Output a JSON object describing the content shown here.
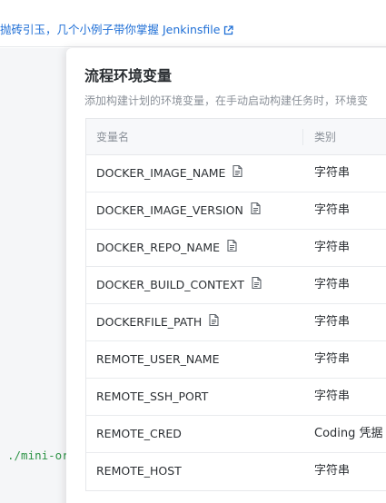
{
  "background": {
    "top_link_text": "抛砖引玉，几个小例子带你掌握 Jenkinsfile",
    "code_snippet": "./mini-or"
  },
  "panel": {
    "title": "流程环境变量",
    "description": "添加构建计划的环境变量，在手动启动构建任务时，环境变",
    "table": {
      "headers": {
        "name": "变量名",
        "type": "类别"
      },
      "rows": [
        {
          "name": "DOCKER_IMAGE_NAME",
          "type": "字符串",
          "has_doc_icon": true
        },
        {
          "name": "DOCKER_IMAGE_VERSION",
          "type": "字符串",
          "has_doc_icon": true
        },
        {
          "name": "DOCKER_REPO_NAME",
          "type": "字符串",
          "has_doc_icon": true
        },
        {
          "name": "DOCKER_BUILD_CONTEXT",
          "type": "字符串",
          "has_doc_icon": true
        },
        {
          "name": "DOCKERFILE_PATH",
          "type": "字符串",
          "has_doc_icon": true
        },
        {
          "name": "REMOTE_USER_NAME",
          "type": "字符串",
          "has_doc_icon": false
        },
        {
          "name": "REMOTE_SSH_PORT",
          "type": "字符串",
          "has_doc_icon": false
        },
        {
          "name": "REMOTE_CRED",
          "type": "Coding 凭据",
          "has_doc_icon": false
        },
        {
          "name": "REMOTE_HOST",
          "type": "字符串",
          "has_doc_icon": false
        }
      ]
    }
  },
  "icons": {
    "external_link": "external-link-icon",
    "document": "document-icon"
  },
  "colors": {
    "link": "#1f6fd6",
    "code_green": "#2e9447",
    "muted_text": "#8b9199",
    "border": "#e6e8eb"
  }
}
